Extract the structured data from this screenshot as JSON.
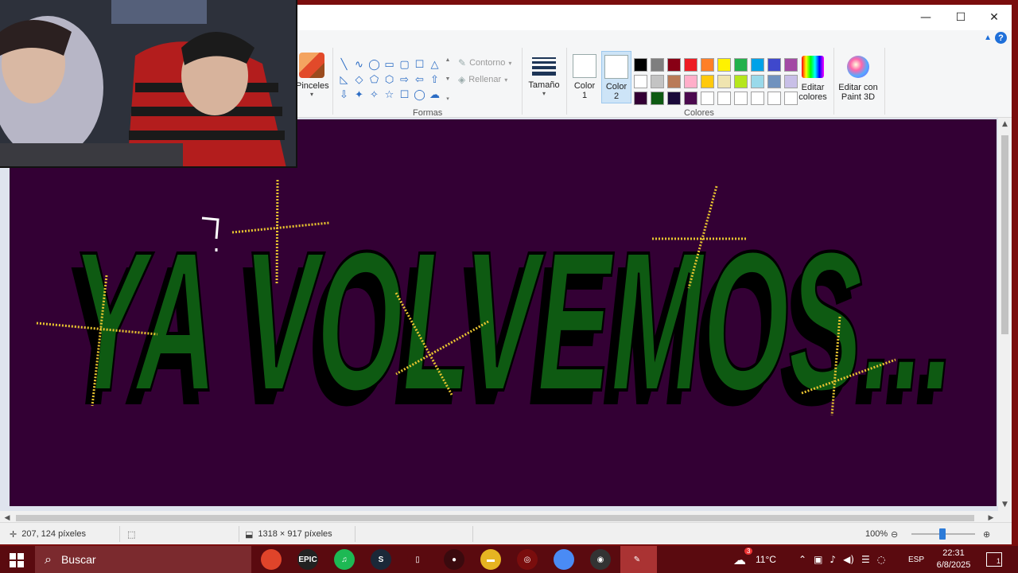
{
  "window": {
    "controls": {
      "minimize": "—",
      "maximize": "☐",
      "close": "✕"
    }
  },
  "ribbon": {
    "brushes_label": "Pinceles",
    "shapes_label": "Formas",
    "outline_label": "Contorno",
    "fill_label": "Rellenar",
    "size_label": "Tamaño",
    "color1_label": "Color\n1",
    "color2_label": "Color\n2",
    "colors_label": "Colores",
    "edit_colors_label": "Editar\ncolores",
    "paint3d_label": "Editar con\nPaint 3D",
    "help_icon": "?",
    "shape_icons": [
      "╲",
      "∿",
      "◯",
      "▭",
      "▢",
      "☐",
      "△",
      "◺",
      "◇",
      "⬠",
      "⬡",
      "⇨",
      "⇦",
      "⇧",
      "⇩",
      "✦",
      "✧",
      "☆",
      "☐",
      "◯",
      "☁"
    ],
    "palette": [
      "#000000",
      "#7f7f7f",
      "#880015",
      "#ed1c24",
      "#ff7f27",
      "#fff200",
      "#22b14c",
      "#00a2e8",
      "#3f48cc",
      "#a349a4",
      "#ffffff",
      "#c3c3c3",
      "#b97a57",
      "#ffaec9",
      "#ffc90e",
      "#efe4b0",
      "#b5e61d",
      "#99d9ea",
      "#7092be",
      "#c8bfe7",
      "#330034",
      "#0e5a12",
      "#1a0a3a",
      "#4b0a4e",
      "#ffffff",
      "#ffffff",
      "#ffffff",
      "#ffffff",
      "#ffffff",
      "#ffffff"
    ]
  },
  "canvas": {
    "background": "#330034",
    "text": "YA VOLVEMOS...",
    "text_color": "#0e5a12"
  },
  "statusbar": {
    "cursor_pos": "207, 124 píxeles",
    "canvas_size": "1318 × 917 píxeles",
    "zoom": "100%"
  },
  "taskbar": {
    "search_placeholder": "Buscar",
    "apps": [
      {
        "name": "chrome",
        "label": "",
        "color": "#e0442a"
      },
      {
        "name": "epic",
        "label": "EPIC",
        "color": "#222222"
      },
      {
        "name": "spotify",
        "label": "♫",
        "color": "#1db954"
      },
      {
        "name": "steam",
        "label": "S",
        "color": "#1b2838"
      },
      {
        "name": "file",
        "label": "▯",
        "color": "#5a0a0f"
      },
      {
        "name": "mouse",
        "label": "●",
        "color": "#3a0a0e"
      },
      {
        "name": "explorer",
        "label": "▬",
        "color": "#e6b422"
      },
      {
        "name": "obs-like",
        "label": "◎",
        "color": "#7a0d0d"
      },
      {
        "name": "chrome2",
        "label": "",
        "color": "#4a8bf5"
      },
      {
        "name": "obs",
        "label": "◉",
        "color": "#333333"
      },
      {
        "name": "paint",
        "label": "✎",
        "color": "#a33"
      }
    ],
    "weather": "11°C",
    "weather_badge": "3",
    "lang": "ESP",
    "time": "22:31",
    "date": "6/8/2025",
    "notif_count": "1"
  }
}
